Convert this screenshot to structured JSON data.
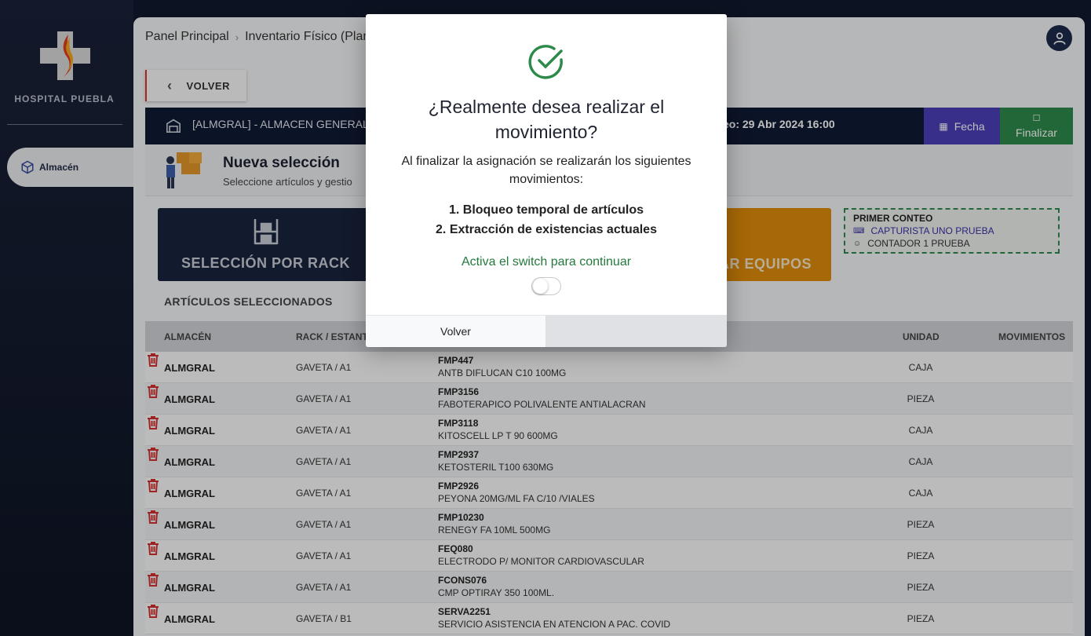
{
  "sidebar": {
    "hospital_name": "HOSPITAL PUEBLA",
    "nav": [
      {
        "label": "Almacén",
        "icon": "box-icon"
      }
    ]
  },
  "breadcrumb": {
    "home": "Panel Principal",
    "current": "Inventario Físico (Plan"
  },
  "back_button": {
    "label": "VOLVER"
  },
  "header": {
    "title": "[ALMGRAL] - ALMACEN GENERAL",
    "date_text": "eo: 29 Abr 2024 16:00",
    "fecha_button": "Fecha",
    "finalizar_button": "Finalizar"
  },
  "selection": {
    "title": "Nueva selección",
    "subtitle": "Seleccione artículos y gestio"
  },
  "cards": {
    "rack_label": "SELECCIÓN POR RACK",
    "equipos_label": "AR EQUIPOS"
  },
  "conteo": {
    "title": "PRIMER CONTEO",
    "capturista": "CAPTURISTA UNO PRUEBA",
    "contador": "CONTADOR 1 PRUEBA"
  },
  "selected_title": "ARTÍCULOS SELECCIONADOS",
  "table": {
    "headers": {
      "almacen": "ALMACÉN",
      "rack": "RACK / ESTANT",
      "unidad": "UNIDAD",
      "movimientos": "MOVIMIENTOS"
    },
    "rows": [
      {
        "almacen": "ALMGRAL",
        "rack": "GAVETA / A1",
        "code": "FMP447",
        "desc": "ANTB DIFLUCAN C10 100MG",
        "unit": "CAJA"
      },
      {
        "almacen": "ALMGRAL",
        "rack": "GAVETA / A1",
        "code": "FMP3156",
        "desc": "FABOTERAPICO POLIVALENTE ANTIALACRAN",
        "unit": "PIEZA"
      },
      {
        "almacen": "ALMGRAL",
        "rack": "GAVETA / A1",
        "code": "FMP3118",
        "desc": "KITOSCELL LP T 90 600MG",
        "unit": "CAJA"
      },
      {
        "almacen": "ALMGRAL",
        "rack": "GAVETA / A1",
        "code": "FMP2937",
        "desc": "KETOSTERIL T100 630MG",
        "unit": "CAJA"
      },
      {
        "almacen": "ALMGRAL",
        "rack": "GAVETA / A1",
        "code": "FMP2926",
        "desc": "PEYONA 20MG/ML FA C/10 /VIALES",
        "unit": "CAJA"
      },
      {
        "almacen": "ALMGRAL",
        "rack": "GAVETA / A1",
        "code": "FMP10230",
        "desc": "RENEGY FA 10ML 500MG",
        "unit": "PIEZA"
      },
      {
        "almacen": "ALMGRAL",
        "rack": "GAVETA / A1",
        "code": "FEQ080",
        "desc": "ELECTRODO P/ MONITOR CARDIOVASCULAR",
        "unit": "PIEZA"
      },
      {
        "almacen": "ALMGRAL",
        "rack": "GAVETA / A1",
        "code": "FCONS076",
        "desc": "CMP OPTIRAY 350 100ML.",
        "unit": "PIEZA"
      },
      {
        "almacen": "ALMGRAL",
        "rack": "GAVETA / B1",
        "code": "SERVA2251",
        "desc": "SERVICIO ASISTENCIA EN ATENCION A PAC. COVID",
        "unit": "PIEZA"
      }
    ]
  },
  "modal": {
    "question": "¿Realmente desea realizar el movimiento?",
    "description": "Al finalizar la asignación se realizarán los siguientes movimientos:",
    "steps": [
      "1. Bloqueo temporal de artículos",
      "2. Extracción de existencias actuales"
    ],
    "switch_label": "Activa el switch para continuar",
    "switch_on": false,
    "volver_button": "Volver",
    "continuar_button": ""
  },
  "colors": {
    "success": "#2e8a4a",
    "fecha": "#4b3fb8",
    "trash": "#d32f2f",
    "navy": "#0f1a33"
  }
}
